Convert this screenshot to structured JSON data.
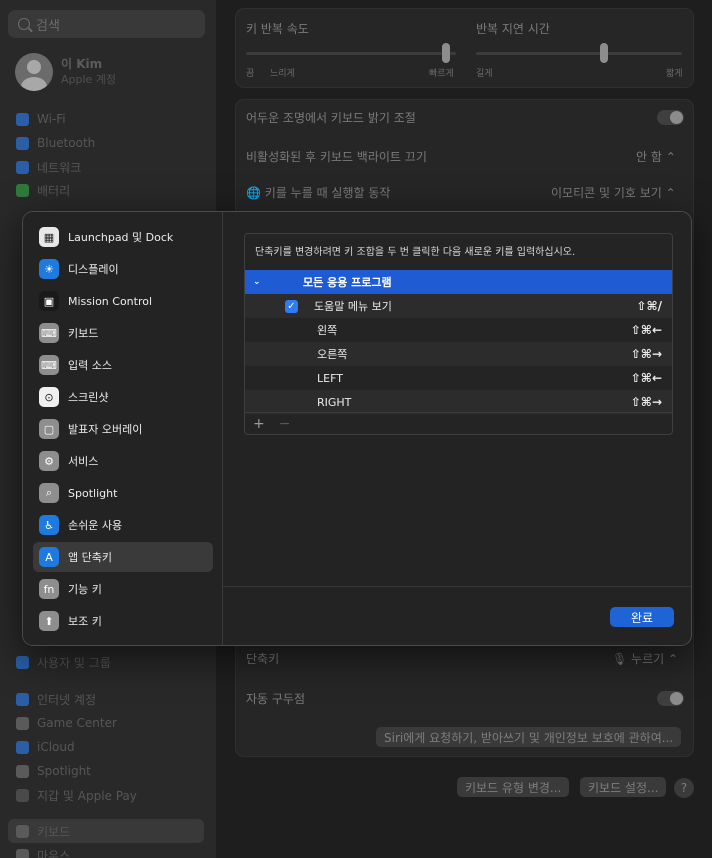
{
  "background": {
    "search_placeholder": "검색",
    "user": {
      "name": "이 Kim",
      "subtitle": "Apple 계정"
    },
    "sidebar_items": [
      {
        "label": "Wi-Fi",
        "color": "#2a5fa8"
      },
      {
        "label": "Bluetooth",
        "color": "#2a5fa8"
      },
      {
        "label": "네트워크",
        "color": "#2a5fa8"
      },
      {
        "label": "배터리",
        "color": "#2f7a3a"
      },
      {
        "label": "사용자 및 그룹",
        "color": "#2a5fa8"
      },
      {
        "label": "인터넷 계정",
        "color": "#2a5fa8"
      },
      {
        "label": "Game Center",
        "color": "#5a5a5a"
      },
      {
        "label": "iCloud",
        "color": "#2a5fa8"
      },
      {
        "label": "Spotlight",
        "color": "#5a5a5a"
      },
      {
        "label": "지갑 및 Apple Pay",
        "color": "#4a4a4a"
      },
      {
        "label": "키보드",
        "color": "#5a5a5a"
      },
      {
        "label": "마우스",
        "color": "#5a5a5a"
      }
    ],
    "key_repeat": {
      "title": "키 반복 속도",
      "labels": [
        "끔",
        "느리게",
        "빠르게"
      ],
      "level": 0.95
    },
    "repeat_delay": {
      "title": "반복 지연 시간",
      "labels": [
        "길게",
        "짧게"
      ],
      "level": 0.62
    },
    "backlight_label": "어두운 조명에서 키보드 밝기 조절",
    "backlight_off_label": "비활성화된 후 키보드 백라이트 끄기",
    "backlight_off_value": "안 함",
    "globe_key_label": "키를 누를 때 실행할 동작",
    "globe_key_value": "이모티콘 및 기호 보기",
    "shortcut_label": "단축키",
    "shortcut_value": "누르기",
    "auto_punct_label": "자동 구두점",
    "siri_button": "Siri에게 요청하기, 받아쓰기 및 개인정보 보호에 관하여...",
    "change_kb_type_button": "키보드 유형 변경...",
    "kb_setup_button": "키보드 설정...",
    "help_button": "?"
  },
  "sheet": {
    "sidebar": [
      {
        "label": "Launchpad 및 Dock",
        "icon": "launchpad-dock-icon",
        "color": "#e8e8e8"
      },
      {
        "label": "디스플레이",
        "icon": "display-icon",
        "color": "#1f7ae0"
      },
      {
        "label": "Mission Control",
        "icon": "mission-control-icon",
        "color": "#1a1a1a"
      },
      {
        "label": "키보드",
        "icon": "keyboard-icon",
        "color": "#8e8e8e"
      },
      {
        "label": "입력 소스",
        "icon": "input-sources-icon",
        "color": "#8e8e8e"
      },
      {
        "label": "스크린샷",
        "icon": "screenshot-icon",
        "color": "#f0f0f0"
      },
      {
        "label": "발표자 오버레이",
        "icon": "presenter-overlay-icon",
        "color": "#8e8e8e"
      },
      {
        "label": "서비스",
        "icon": "services-icon",
        "color": "#8e8e8e"
      },
      {
        "label": "Spotlight",
        "icon": "spotlight-icon",
        "color": "#8e8e8e"
      },
      {
        "label": "손쉬운 사용",
        "icon": "accessibility-icon",
        "color": "#1f7ae0"
      },
      {
        "label": "앱 단축키",
        "icon": "app-shortcuts-icon",
        "color": "#1f7ae0"
      },
      {
        "label": "기능 키",
        "icon": "function-keys-icon",
        "color": "#8e8e8e"
      },
      {
        "label": "보조 키",
        "icon": "modifier-keys-icon",
        "color": "#8e8e8e"
      }
    ],
    "selected_index": 10,
    "info": "단축키를 변경하려면 키 조합을 두 번 클릭한 다음 새로운 키를 입력하십시오.",
    "group_label": "모든 응용 프로그램",
    "rows": [
      {
        "label": "도움말 메뉴 보기",
        "keys": "⇧⌘/",
        "checked": true
      },
      {
        "label": "왼쪽",
        "keys": "⇧⌘←"
      },
      {
        "label": "오른쪽",
        "keys": "⇧⌘→"
      },
      {
        "label": "LEFT",
        "keys": "⇧⌘←"
      },
      {
        "label": "RIGHT",
        "keys": "⇧⌘→"
      }
    ],
    "add_symbol": "+",
    "remove_symbol": "−",
    "done_label": "완료",
    "accent": "#1f5bd2"
  }
}
